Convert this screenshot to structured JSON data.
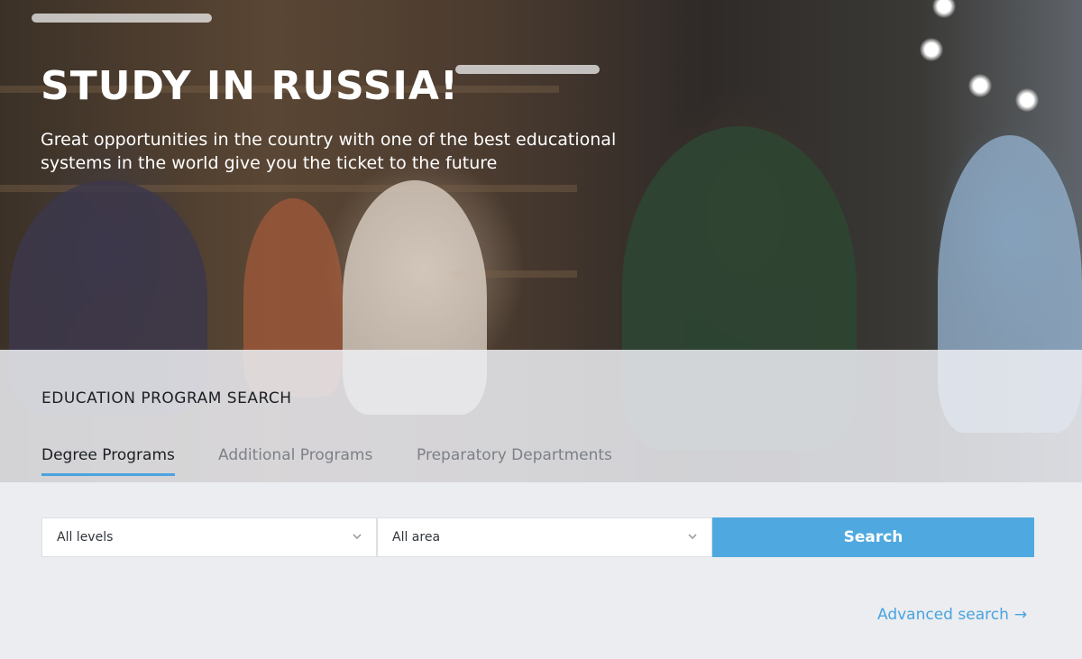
{
  "hero": {
    "title": "STUDY IN RUSSIA!",
    "subtitle": "Great opportunities in the country with one of the best educational systems in the world give you the ticket to the future"
  },
  "search": {
    "heading": "EDUCATION PROGRAM SEARCH",
    "tabs": [
      {
        "label": "Degree Programs",
        "active": true
      },
      {
        "label": "Additional Programs",
        "active": false
      },
      {
        "label": "Preparatory Departments",
        "active": false
      }
    ],
    "level_select": {
      "value": "All levels"
    },
    "area_select": {
      "value": "All area"
    },
    "button_label": "Search",
    "advanced_label": "Advanced search",
    "advanced_arrow": "→"
  },
  "icons": {
    "chevron": "chevron-down-icon",
    "arrow": "arrow-right-icon"
  },
  "colors": {
    "accent": "#4fa9e0",
    "text_dark": "#1b1f24",
    "text_muted": "#7c8188",
    "panel_bg": "#ebedf1"
  }
}
